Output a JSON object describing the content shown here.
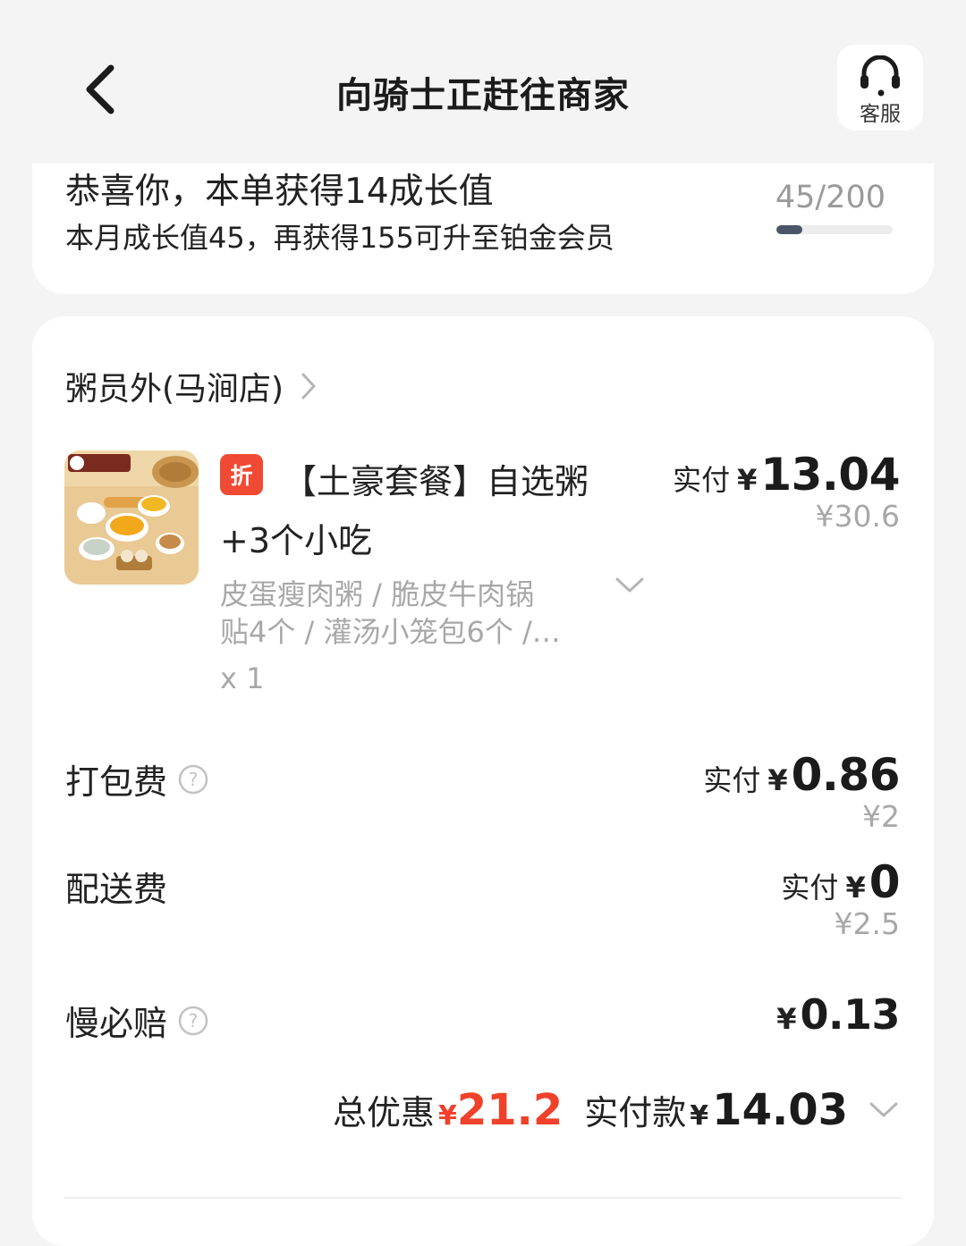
{
  "header": {
    "title": "向骑士正赶往商家",
    "customer_service_label": "客服",
    "icons": {
      "back": "chevron-left-icon",
      "service": "headset-icon"
    }
  },
  "growth": {
    "title": "恭喜你，本单获得14成长值",
    "subtitle": "本月成长值45，再获得155可升至铂金会员",
    "progress_text": "45/200",
    "progress_fraction": 0.225,
    "progress_color": "#4a5568"
  },
  "store": {
    "name": "粥员外(马涧店)"
  },
  "item": {
    "badge": "折",
    "name_line1": "【土豪套餐】自选粥",
    "name_line2": "+3个小吃",
    "desc_line1": "皮蛋瘦肉粥 / 脆皮牛肉锅",
    "desc_line2": "贴4个 / 灌汤小笼包6个 /…",
    "qty": "x 1",
    "paid_label": "实付",
    "currency": "¥",
    "paid": "13.04",
    "original": "¥30.6"
  },
  "fees": {
    "packing": {
      "label": "打包费",
      "paid_label": "实付",
      "currency": "¥",
      "paid": "0.86",
      "original": "¥2"
    },
    "delivery": {
      "label": "配送费",
      "paid_label": "实付",
      "currency": "¥",
      "paid": "0",
      "original": "¥2.5"
    },
    "slow": {
      "label": "慢必赔",
      "currency": "¥",
      "amount": "0.13"
    }
  },
  "total": {
    "discount_label": "总优惠",
    "currency": "¥",
    "discount": "21.2",
    "paid_label": "实付款",
    "paid": "14.03"
  },
  "colors": {
    "accent_red": "#f0412b",
    "badge_red": "#f04a34",
    "background": "#f4f4f4"
  }
}
